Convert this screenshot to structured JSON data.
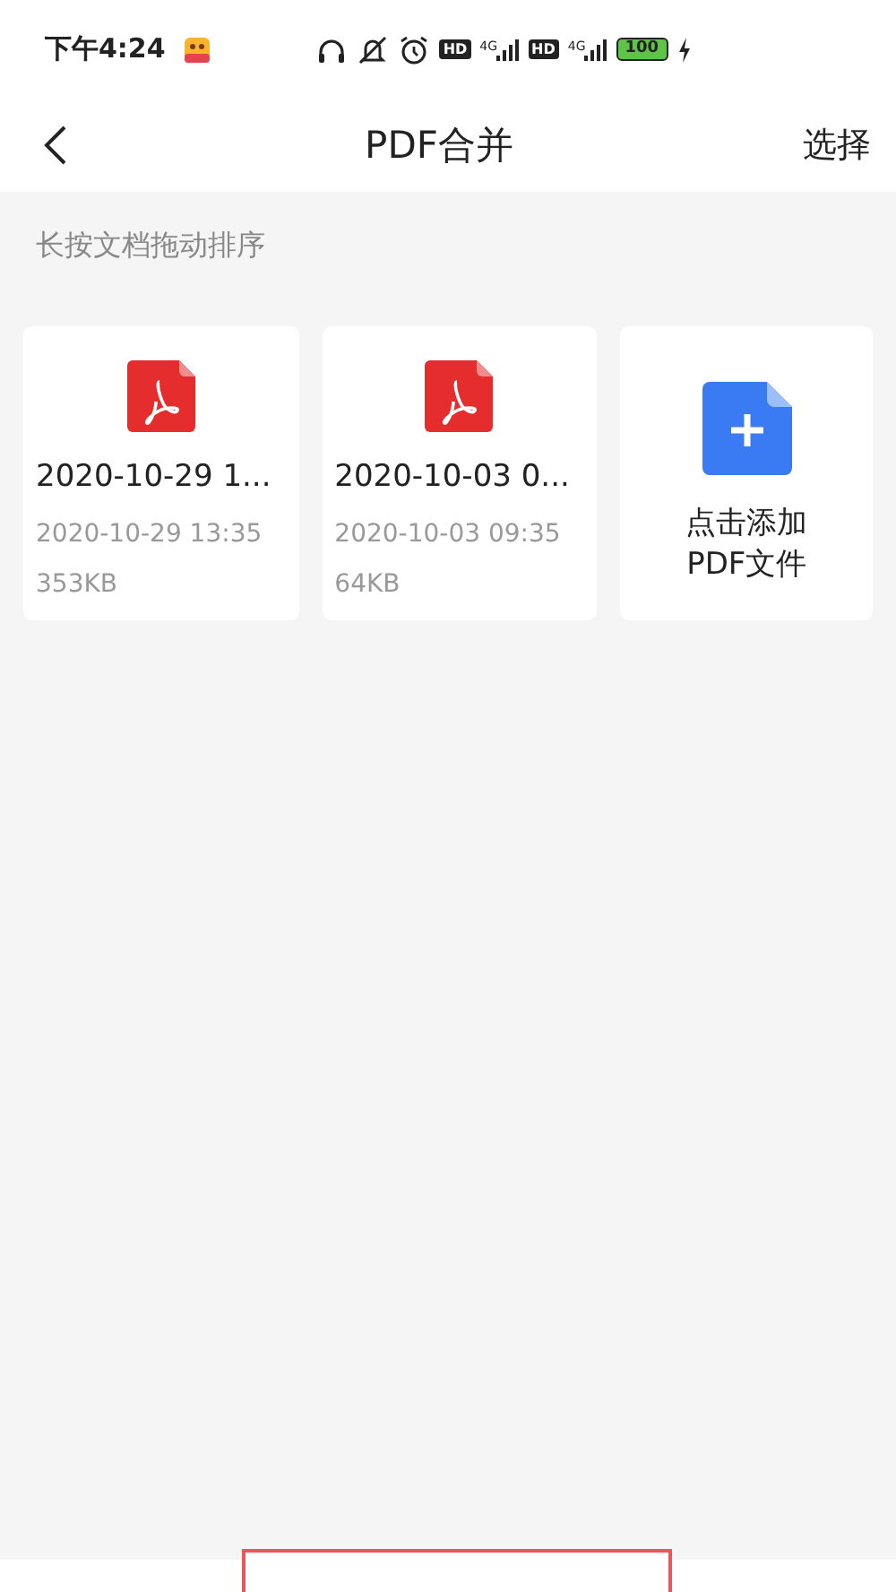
{
  "status_bar": {
    "time": "下午4:24",
    "icons": [
      {
        "kind": "app"
      },
      {
        "kind": "headphones"
      },
      {
        "kind": "bell-off"
      },
      {
        "kind": "alarm"
      },
      {
        "kind": "hd",
        "text": "HD"
      },
      {
        "kind": "signal",
        "text": "4G"
      },
      {
        "kind": "hd",
        "text": "HD"
      },
      {
        "kind": "signal",
        "text": "4G"
      },
      {
        "kind": "battery",
        "text": "100"
      },
      {
        "kind": "charging"
      }
    ]
  },
  "nav": {
    "title": "PDF合并",
    "action": "选择"
  },
  "hint": "长按文档拖动排序",
  "files": [
    {
      "kind": "pdf",
      "name": "2020-10-29 1...",
      "date": "2020-10-29 13:35",
      "size": "353KB"
    },
    {
      "kind": "pdf",
      "name": "2020-10-03 0...",
      "date": "2020-10-03 09:35",
      "size": "64KB"
    },
    {
      "kind": "add",
      "lines": [
        "点击添加",
        "PDF文件"
      ]
    }
  ],
  "bottom_bar": {
    "highlight": true
  }
}
